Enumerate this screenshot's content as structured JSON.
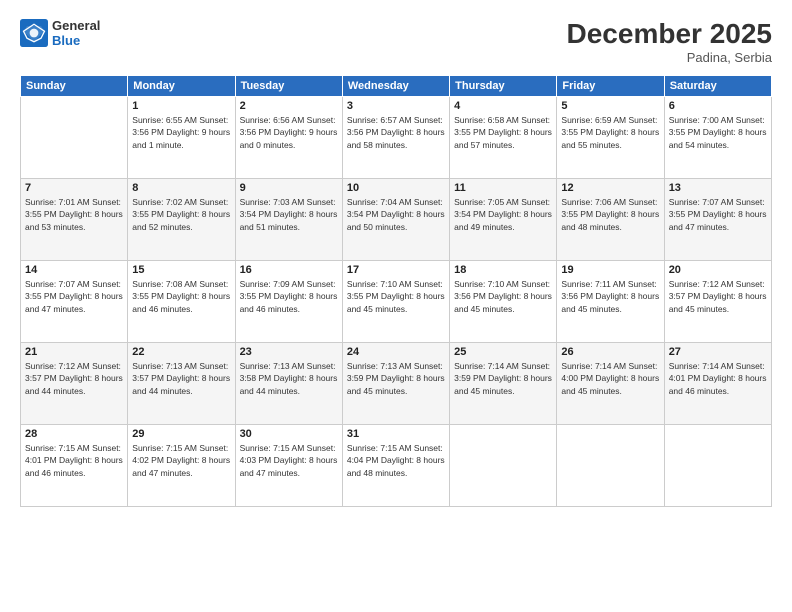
{
  "header": {
    "logo_general": "General",
    "logo_blue": "Blue",
    "month": "December 2025",
    "location": "Padina, Serbia"
  },
  "days_of_week": [
    "Sunday",
    "Monday",
    "Tuesday",
    "Wednesday",
    "Thursday",
    "Friday",
    "Saturday"
  ],
  "weeks": [
    [
      {
        "day": "",
        "info": ""
      },
      {
        "day": "1",
        "info": "Sunrise: 6:55 AM\nSunset: 3:56 PM\nDaylight: 9 hours\nand 1 minute."
      },
      {
        "day": "2",
        "info": "Sunrise: 6:56 AM\nSunset: 3:56 PM\nDaylight: 9 hours\nand 0 minutes."
      },
      {
        "day": "3",
        "info": "Sunrise: 6:57 AM\nSunset: 3:56 PM\nDaylight: 8 hours\nand 58 minutes."
      },
      {
        "day": "4",
        "info": "Sunrise: 6:58 AM\nSunset: 3:55 PM\nDaylight: 8 hours\nand 57 minutes."
      },
      {
        "day": "5",
        "info": "Sunrise: 6:59 AM\nSunset: 3:55 PM\nDaylight: 8 hours\nand 55 minutes."
      },
      {
        "day": "6",
        "info": "Sunrise: 7:00 AM\nSunset: 3:55 PM\nDaylight: 8 hours\nand 54 minutes."
      }
    ],
    [
      {
        "day": "7",
        "info": "Sunrise: 7:01 AM\nSunset: 3:55 PM\nDaylight: 8 hours\nand 53 minutes."
      },
      {
        "day": "8",
        "info": "Sunrise: 7:02 AM\nSunset: 3:55 PM\nDaylight: 8 hours\nand 52 minutes."
      },
      {
        "day": "9",
        "info": "Sunrise: 7:03 AM\nSunset: 3:54 PM\nDaylight: 8 hours\nand 51 minutes."
      },
      {
        "day": "10",
        "info": "Sunrise: 7:04 AM\nSunset: 3:54 PM\nDaylight: 8 hours\nand 50 minutes."
      },
      {
        "day": "11",
        "info": "Sunrise: 7:05 AM\nSunset: 3:54 PM\nDaylight: 8 hours\nand 49 minutes."
      },
      {
        "day": "12",
        "info": "Sunrise: 7:06 AM\nSunset: 3:55 PM\nDaylight: 8 hours\nand 48 minutes."
      },
      {
        "day": "13",
        "info": "Sunrise: 7:07 AM\nSunset: 3:55 PM\nDaylight: 8 hours\nand 47 minutes."
      }
    ],
    [
      {
        "day": "14",
        "info": "Sunrise: 7:07 AM\nSunset: 3:55 PM\nDaylight: 8 hours\nand 47 minutes."
      },
      {
        "day": "15",
        "info": "Sunrise: 7:08 AM\nSunset: 3:55 PM\nDaylight: 8 hours\nand 46 minutes."
      },
      {
        "day": "16",
        "info": "Sunrise: 7:09 AM\nSunset: 3:55 PM\nDaylight: 8 hours\nand 46 minutes."
      },
      {
        "day": "17",
        "info": "Sunrise: 7:10 AM\nSunset: 3:55 PM\nDaylight: 8 hours\nand 45 minutes."
      },
      {
        "day": "18",
        "info": "Sunrise: 7:10 AM\nSunset: 3:56 PM\nDaylight: 8 hours\nand 45 minutes."
      },
      {
        "day": "19",
        "info": "Sunrise: 7:11 AM\nSunset: 3:56 PM\nDaylight: 8 hours\nand 45 minutes."
      },
      {
        "day": "20",
        "info": "Sunrise: 7:12 AM\nSunset: 3:57 PM\nDaylight: 8 hours\nand 45 minutes."
      }
    ],
    [
      {
        "day": "21",
        "info": "Sunrise: 7:12 AM\nSunset: 3:57 PM\nDaylight: 8 hours\nand 44 minutes."
      },
      {
        "day": "22",
        "info": "Sunrise: 7:13 AM\nSunset: 3:57 PM\nDaylight: 8 hours\nand 44 minutes."
      },
      {
        "day": "23",
        "info": "Sunrise: 7:13 AM\nSunset: 3:58 PM\nDaylight: 8 hours\nand 44 minutes."
      },
      {
        "day": "24",
        "info": "Sunrise: 7:13 AM\nSunset: 3:59 PM\nDaylight: 8 hours\nand 45 minutes."
      },
      {
        "day": "25",
        "info": "Sunrise: 7:14 AM\nSunset: 3:59 PM\nDaylight: 8 hours\nand 45 minutes."
      },
      {
        "day": "26",
        "info": "Sunrise: 7:14 AM\nSunset: 4:00 PM\nDaylight: 8 hours\nand 45 minutes."
      },
      {
        "day": "27",
        "info": "Sunrise: 7:14 AM\nSunset: 4:01 PM\nDaylight: 8 hours\nand 46 minutes."
      }
    ],
    [
      {
        "day": "28",
        "info": "Sunrise: 7:15 AM\nSunset: 4:01 PM\nDaylight: 8 hours\nand 46 minutes."
      },
      {
        "day": "29",
        "info": "Sunrise: 7:15 AM\nSunset: 4:02 PM\nDaylight: 8 hours\nand 47 minutes."
      },
      {
        "day": "30",
        "info": "Sunrise: 7:15 AM\nSunset: 4:03 PM\nDaylight: 8 hours\nand 47 minutes."
      },
      {
        "day": "31",
        "info": "Sunrise: 7:15 AM\nSunset: 4:04 PM\nDaylight: 8 hours\nand 48 minutes."
      },
      {
        "day": "",
        "info": ""
      },
      {
        "day": "",
        "info": ""
      },
      {
        "day": "",
        "info": ""
      }
    ]
  ]
}
